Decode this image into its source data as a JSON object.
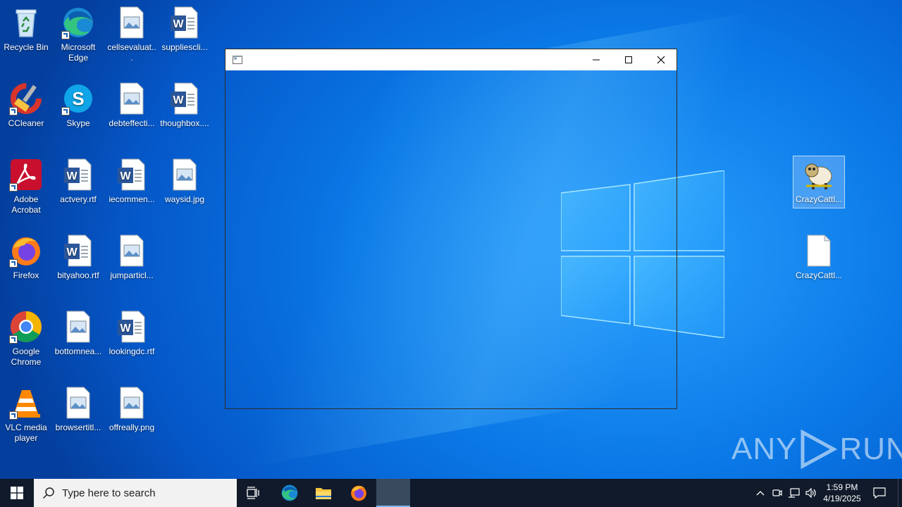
{
  "desktop": {
    "icons": [
      {
        "label": "Recycle Bin",
        "icon": "recycle-bin-icon"
      },
      {
        "label": "Microsoft Edge",
        "icon": "edge-icon"
      },
      {
        "label": "cellsevaluat...",
        "icon": "image-file-icon"
      },
      {
        "label": "suppliescli...",
        "icon": "word-document-icon"
      },
      {
        "label": "CCleaner",
        "icon": "ccleaner-icon"
      },
      {
        "label": "Skype",
        "icon": "skype-icon"
      },
      {
        "label": "debteffecti...",
        "icon": "image-file-icon"
      },
      {
        "label": "thoughbox....",
        "icon": "word-document-icon"
      },
      {
        "label": "Adobe Acrobat",
        "icon": "acrobat-icon"
      },
      {
        "label": "actvery.rtf",
        "icon": "word-document-icon"
      },
      {
        "label": "iecommen...",
        "icon": "word-document-icon"
      },
      {
        "label": "waysid.jpg",
        "icon": "image-file-icon"
      },
      {
        "label": "Firefox",
        "icon": "firefox-icon"
      },
      {
        "label": "bityahoo.rtf",
        "icon": "word-document-icon"
      },
      {
        "label": "jumparticl...",
        "icon": "image-file-icon"
      },
      {
        "label": "Google Chrome",
        "icon": "chrome-icon"
      },
      {
        "label": "bottomnea...",
        "icon": "image-file-icon"
      },
      {
        "label": "lookingdc.rtf",
        "icon": "word-document-icon"
      },
      {
        "label": "VLC media player",
        "icon": "vlc-icon"
      },
      {
        "label": "browsertitl...",
        "icon": "image-file-icon"
      },
      {
        "label": "offreally.png",
        "icon": "image-file-icon"
      },
      {
        "label": "CrazyCattl...",
        "icon": "sheep-app-icon"
      },
      {
        "label": "CrazyCattl...",
        "icon": "blank-file-icon"
      }
    ]
  },
  "window": {
    "title": "",
    "minimize_label": "Minimize",
    "maximize_label": "Maximize",
    "close_label": "Close"
  },
  "watermark": {
    "text_left": "ANY",
    "text_right": "RUN"
  },
  "taskbar": {
    "search_placeholder": "Type here to search",
    "clock_time": "1:59 PM",
    "clock_date": "4/19/2025",
    "colors": {
      "background": "#101a2a",
      "active_indicator": "#76b9ed"
    }
  }
}
